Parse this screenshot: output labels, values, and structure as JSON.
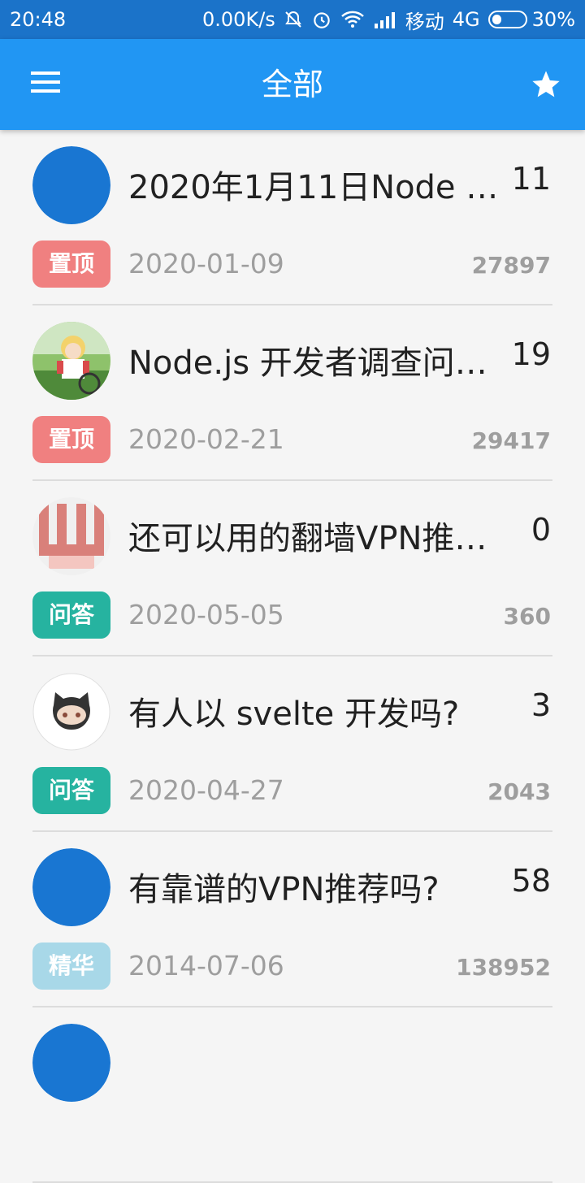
{
  "status_bar": {
    "time": "20:48",
    "speed": "0.00K/s",
    "carrier": "移动",
    "network": "4G",
    "battery": "30%",
    "battery_level": 0.3
  },
  "app_bar": {
    "title": "全部",
    "menu_icon": "hamburger-menu-icon",
    "star_icon": "star-icon"
  },
  "topics": [
    {
      "title": "2020年1月11日Node …",
      "replies": "11",
      "tag": "置顶",
      "tag_color": "#f08080",
      "date": "2020-01-09",
      "views": "27897",
      "avatar": "blue-circle"
    },
    {
      "title": "Node.js 开发者调查问…",
      "replies": "19",
      "tag": "置顶",
      "tag_color": "#f08080",
      "date": "2020-02-21",
      "views": "29417",
      "avatar": "anime-boy"
    },
    {
      "title": "还可以用的翻墙VPN推…",
      "replies": "0",
      "tag": "问答",
      "tag_color": "#26b3a0",
      "date": "2020-05-05",
      "views": "360",
      "avatar": "pink-pixel"
    },
    {
      "title": "有人以 svelte 开发吗?",
      "replies": "3",
      "tag": "问答",
      "tag_color": "#26b3a0",
      "date": "2020-04-27",
      "views": "2043",
      "avatar": "github-octocat"
    },
    {
      "title": "有靠谱的VPN推荐吗?",
      "replies": "58",
      "tag": "精华",
      "tag_color": "#a8d8e8",
      "date": "2014-07-06",
      "views": "138952",
      "avatar": "blue-circle"
    }
  ],
  "colors": {
    "status_bar": "#1b73c9",
    "app_bar": "#2196f3",
    "avatar_blue": "#1976d2"
  }
}
